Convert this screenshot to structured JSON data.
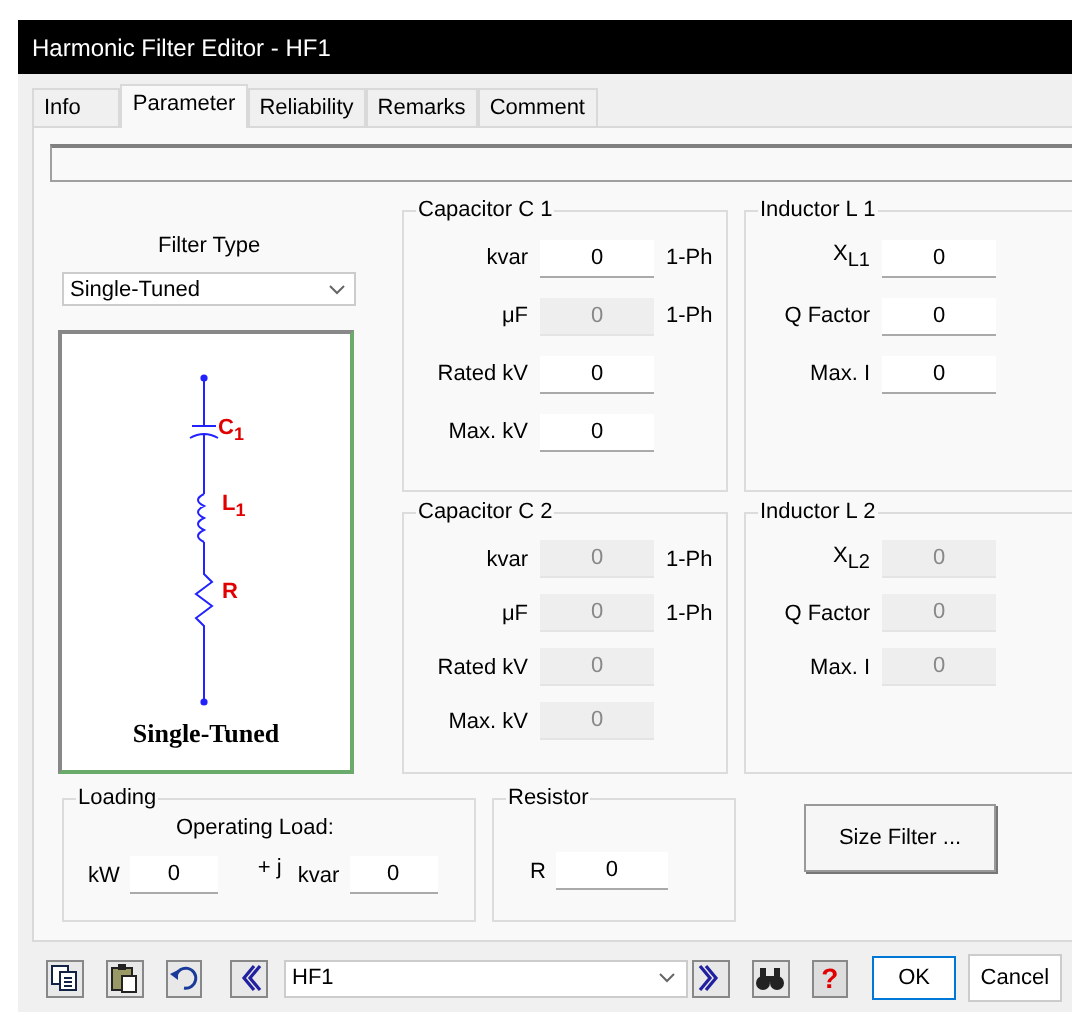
{
  "window": {
    "title": "Harmonic Filter Editor - HF1"
  },
  "tabs": [
    {
      "label": "Info",
      "selected": false
    },
    {
      "label": "Parameter",
      "selected": true
    },
    {
      "label": "Reliability",
      "selected": false
    },
    {
      "label": "Remarks",
      "selected": false
    },
    {
      "label": "Comment",
      "selected": false
    }
  ],
  "filter_type": {
    "label": "Filter Type",
    "value": "Single-Tuned"
  },
  "diagram": {
    "caption": "Single-Tuned",
    "labels": [
      "C$_{1}$",
      "L$_{1}$",
      "R"
    ]
  },
  "groups": [
    {
      "title": "Capacitor C 1",
      "fields": [
        {
          "label": "kvar",
          "value": "0",
          "unit": "1-Ph",
          "disabled": false
        },
        {
          "label": "μF",
          "value": "0",
          "unit": "1-Ph",
          "disabled": true
        },
        {
          "label": "Rated kV",
          "value": "0",
          "disabled": false
        },
        {
          "label": "Max. kV",
          "value": "0",
          "disabled": false
        }
      ]
    },
    {
      "title": "Inductor L 1",
      "fields": [
        {
          "label": "X$_{L1}$",
          "value": "0",
          "disabled": false
        },
        {
          "label": "Q Factor",
          "value": "0",
          "disabled": false
        },
        {
          "label": "Max. I",
          "value": "0",
          "disabled": false
        }
      ]
    },
    {
      "title": "Capacitor C 2",
      "fields": [
        {
          "label": "kvar",
          "value": "0",
          "unit": "1-Ph",
          "disabled": true
        },
        {
          "label": "μF",
          "value": "0",
          "unit": "1-Ph",
          "disabled": true
        },
        {
          "label": "Rated kV",
          "value": "0",
          "disabled": true
        },
        {
          "label": "Max. kV",
          "value": "0",
          "disabled": true
        }
      ]
    },
    {
      "title": "Inductor L 2",
      "fields": [
        {
          "label": "X$_{L2}$",
          "value": "0",
          "disabled": true
        },
        {
          "label": "Q Factor",
          "value": "0",
          "disabled": true
        },
        {
          "label": "Max. I",
          "value": "0",
          "disabled": true
        }
      ]
    }
  ],
  "loading": {
    "title": "Loading",
    "subtitle": "Operating Load:",
    "kw_label": "kW",
    "kw": "0",
    "j_label": "+ j",
    "kvar_label": "kvar",
    "kvar": "0"
  },
  "resistor": {
    "title": "Resistor",
    "label": "R",
    "value": "0"
  },
  "size_button": "Size Filter ...",
  "footer": {
    "selector": "HF1",
    "help": "?",
    "ok": "OK",
    "cancel": "Cancel"
  }
}
